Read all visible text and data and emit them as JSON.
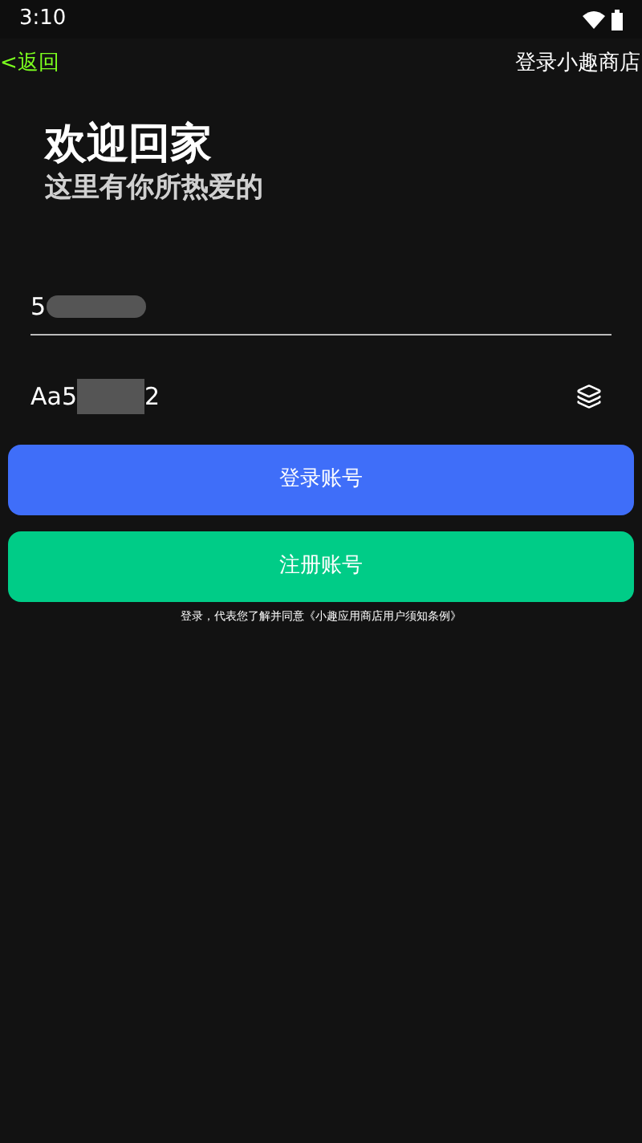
{
  "status_bar": {
    "time": "3:10"
  },
  "nav": {
    "back": "<返回",
    "title": "登录小趣商店"
  },
  "heading": {
    "title": "欢迎回家",
    "subtitle": "这里有你所热爱的"
  },
  "username": {
    "value_before": "5"
  },
  "password": {
    "value_before": "Aa5",
    "value_after": "2"
  },
  "buttons": [
    {
      "label": "登录账号",
      "kind": "primary"
    },
    {
      "label": "注册账号",
      "kind": "secondary"
    }
  ],
  "terms": "登录，代表您了解并同意《小趣应用商店用户须知条例》"
}
